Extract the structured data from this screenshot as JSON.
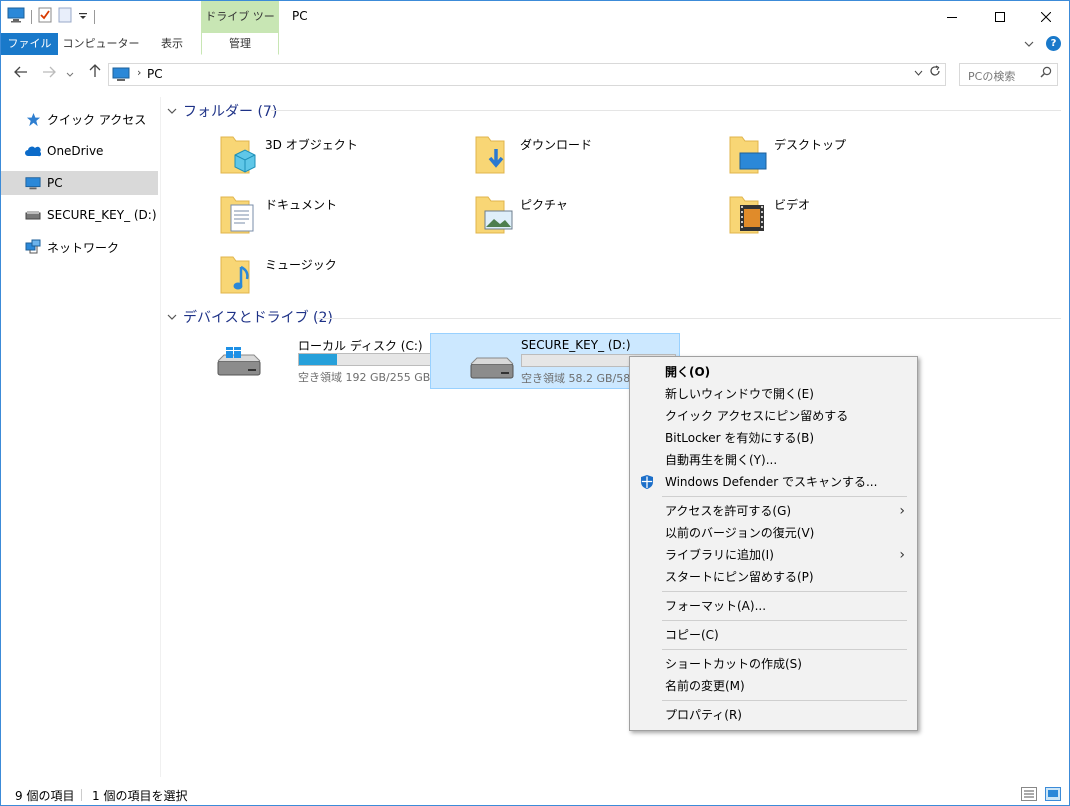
{
  "titlebar": {
    "tool_context": "ドライブ ツール",
    "title": "PC",
    "minimize": "—",
    "maximize": "☐",
    "close": "✕"
  },
  "ribbon": {
    "tabs": [
      "ファイル",
      "コンピューター",
      "表示",
      "管理"
    ],
    "help": "?"
  },
  "address": {
    "path": "PC",
    "search_placeholder": "PCの検索"
  },
  "sidebar": {
    "items": [
      {
        "label": "クイック アクセス",
        "icon": "star-icon"
      },
      {
        "label": "OneDrive",
        "icon": "cloud-icon"
      },
      {
        "label": "PC",
        "icon": "computer-icon"
      },
      {
        "label": "SECURE_KEY_ (D:)",
        "icon": "drive-icon"
      },
      {
        "label": "ネットワーク",
        "icon": "network-icon"
      }
    ]
  },
  "folders_group": {
    "title": "フォルダー (7)",
    "items": [
      "3D オブジェクト",
      "ダウンロード",
      "デスクトップ",
      "ドキュメント",
      "ピクチャ",
      "ビデオ",
      "ミュージック"
    ]
  },
  "drives_group": {
    "title": "デバイスとドライブ (2)",
    "drives": [
      {
        "name": "ローカル ディスク (C:)",
        "free": "空き領域 192 GB/255 GB",
        "used_fraction": 0.25
      },
      {
        "name": "SECURE_KEY_ (D:)",
        "free": "空き領域 58.2 GB/58.",
        "used_fraction": 0.0
      }
    ]
  },
  "context_menu": {
    "items": [
      {
        "label": "開く(O)"
      },
      {
        "label": "新しいウィンドウで開く(E)"
      },
      {
        "label": "クイック アクセスにピン留めする"
      },
      {
        "label": "BitLocker を有効にする(B)"
      },
      {
        "label": "自動再生を開く(Y)..."
      },
      {
        "label": "Windows Defender でスキャンする..."
      },
      {
        "label": "アクセスを許可する(G)"
      },
      {
        "label": "以前のバージョンの復元(V)"
      },
      {
        "label": "ライブラリに追加(I)"
      },
      {
        "label": "スタートにピン留めする(P)"
      },
      {
        "label": "フォーマット(A)..."
      },
      {
        "label": "コピー(C)"
      },
      {
        "label": "ショートカットの作成(S)"
      },
      {
        "label": "名前の変更(M)"
      },
      {
        "label": "プロパティ(R)"
      }
    ],
    "submenu_arrow": "›"
  },
  "status": {
    "item_count": "9 個の項目",
    "selected": "1 個の項目を選択"
  },
  "colors": {
    "accent": "#1979ca",
    "selection": "#cce8ff",
    "drive_fill": "#26a0da",
    "folder": "#f8d675"
  }
}
